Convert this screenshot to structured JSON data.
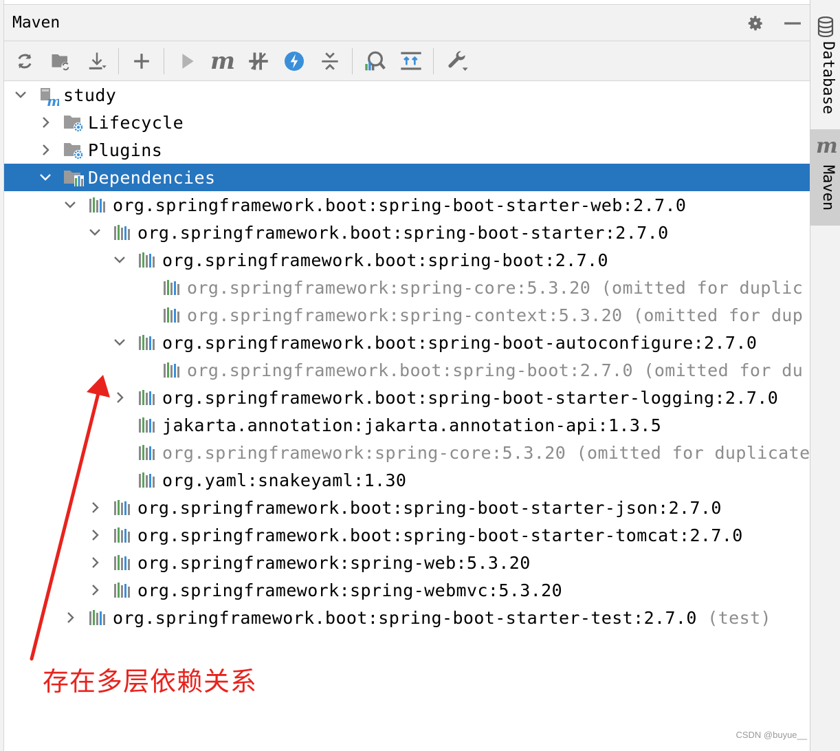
{
  "panel": {
    "title": "Maven",
    "settings_icon": "gear-icon",
    "minimize_icon": "minus-icon"
  },
  "toolbar": [
    {
      "name": "reload-all-icon"
    },
    {
      "name": "generate-sources-icon"
    },
    {
      "name": "download-icon"
    },
    {
      "name": "add-icon"
    },
    {
      "name": "run-icon"
    },
    {
      "name": "execute-goal-icon"
    },
    {
      "name": "toggle-offline-icon"
    },
    {
      "name": "skip-tests-icon"
    },
    {
      "name": "collapse-all-icon"
    },
    {
      "name": "analyze-dependencies-icon"
    },
    {
      "name": "show-diagram-icon"
    },
    {
      "name": "build-tool-settings-icon"
    }
  ],
  "tree": {
    "rows": [
      {
        "label": "study",
        "suffix": "",
        "level": 0,
        "expand": "open",
        "icon": "module",
        "dim": false,
        "selected": false
      },
      {
        "label": "Lifecycle",
        "suffix": "",
        "level": 1,
        "expand": "closed",
        "icon": "folder-gear",
        "dim": false,
        "selected": false
      },
      {
        "label": "Plugins",
        "suffix": "",
        "level": 1,
        "expand": "closed",
        "icon": "folder-gear",
        "dim": false,
        "selected": false
      },
      {
        "label": "Dependencies",
        "suffix": "",
        "level": 1,
        "expand": "open",
        "icon": "folder-lib",
        "dim": false,
        "selected": true
      },
      {
        "label": "org.springframework.boot:spring-boot-starter-web:2.7.0",
        "suffix": "",
        "level": 2,
        "expand": "open",
        "icon": "lib",
        "dim": false,
        "selected": false
      },
      {
        "label": "org.springframework.boot:spring-boot-starter:2.7.0",
        "suffix": "",
        "level": 3,
        "expand": "open",
        "icon": "lib",
        "dim": false,
        "selected": false
      },
      {
        "label": "org.springframework.boot:spring-boot:2.7.0",
        "suffix": "",
        "level": 4,
        "expand": "open",
        "icon": "lib",
        "dim": false,
        "selected": false
      },
      {
        "label": "org.springframework:spring-core:5.3.20",
        "suffix": " (omitted for duplic",
        "level": 5,
        "expand": "none",
        "icon": "lib",
        "dim": true,
        "selected": false
      },
      {
        "label": "org.springframework:spring-context:5.3.20",
        "suffix": " (omitted for dup",
        "level": 5,
        "expand": "none",
        "icon": "lib",
        "dim": true,
        "selected": false
      },
      {
        "label": "org.springframework.boot:spring-boot-autoconfigure:2.7.0",
        "suffix": "",
        "level": 4,
        "expand": "open",
        "icon": "lib",
        "dim": false,
        "selected": false
      },
      {
        "label": "org.springframework.boot:spring-boot:2.7.0",
        "suffix": " (omitted for du",
        "level": 5,
        "expand": "none",
        "icon": "lib",
        "dim": true,
        "selected": false
      },
      {
        "label": "org.springframework.boot:spring-boot-starter-logging:2.7.0",
        "suffix": "",
        "level": 4,
        "expand": "closed",
        "icon": "lib",
        "dim": false,
        "selected": false
      },
      {
        "label": "jakarta.annotation:jakarta.annotation-api:1.3.5",
        "suffix": "",
        "level": 4,
        "expand": "none",
        "icon": "lib",
        "dim": false,
        "selected": false
      },
      {
        "label": "org.springframework:spring-core:5.3.20",
        "suffix": " (omitted for duplicate",
        "level": 4,
        "expand": "none",
        "icon": "lib",
        "dim": true,
        "selected": false
      },
      {
        "label": "org.yaml:snakeyaml:1.30",
        "suffix": "",
        "level": 4,
        "expand": "none",
        "icon": "lib",
        "dim": false,
        "selected": false
      },
      {
        "label": "org.springframework.boot:spring-boot-starter-json:2.7.0",
        "suffix": "",
        "level": 3,
        "expand": "closed",
        "icon": "lib",
        "dim": false,
        "selected": false
      },
      {
        "label": "org.springframework.boot:spring-boot-starter-tomcat:2.7.0",
        "suffix": "",
        "level": 3,
        "expand": "closed",
        "icon": "lib",
        "dim": false,
        "selected": false
      },
      {
        "label": "org.springframework:spring-web:5.3.20",
        "suffix": "",
        "level": 3,
        "expand": "closed",
        "icon": "lib",
        "dim": false,
        "selected": false
      },
      {
        "label": "org.springframework:spring-webmvc:5.3.20",
        "suffix": "",
        "level": 3,
        "expand": "closed",
        "icon": "lib",
        "dim": false,
        "selected": false
      },
      {
        "label": "org.springframework.boot:spring-boot-starter-test:2.7.0",
        "suffix": " (test)",
        "level": 2,
        "expand": "closed",
        "icon": "lib",
        "dim": false,
        "selected": false
      }
    ]
  },
  "side_strip": {
    "database_label": "Database",
    "maven_label": "Maven",
    "maven_glyph": "m"
  },
  "annotation": {
    "text": "存在多层依赖关系",
    "color": "#e8231d"
  },
  "watermark": "CSDN @buyue__",
  "colors": {
    "selection": "#2675bf",
    "dim_text": "#8c8c8c",
    "panel_bg": "#f2f2f2"
  }
}
